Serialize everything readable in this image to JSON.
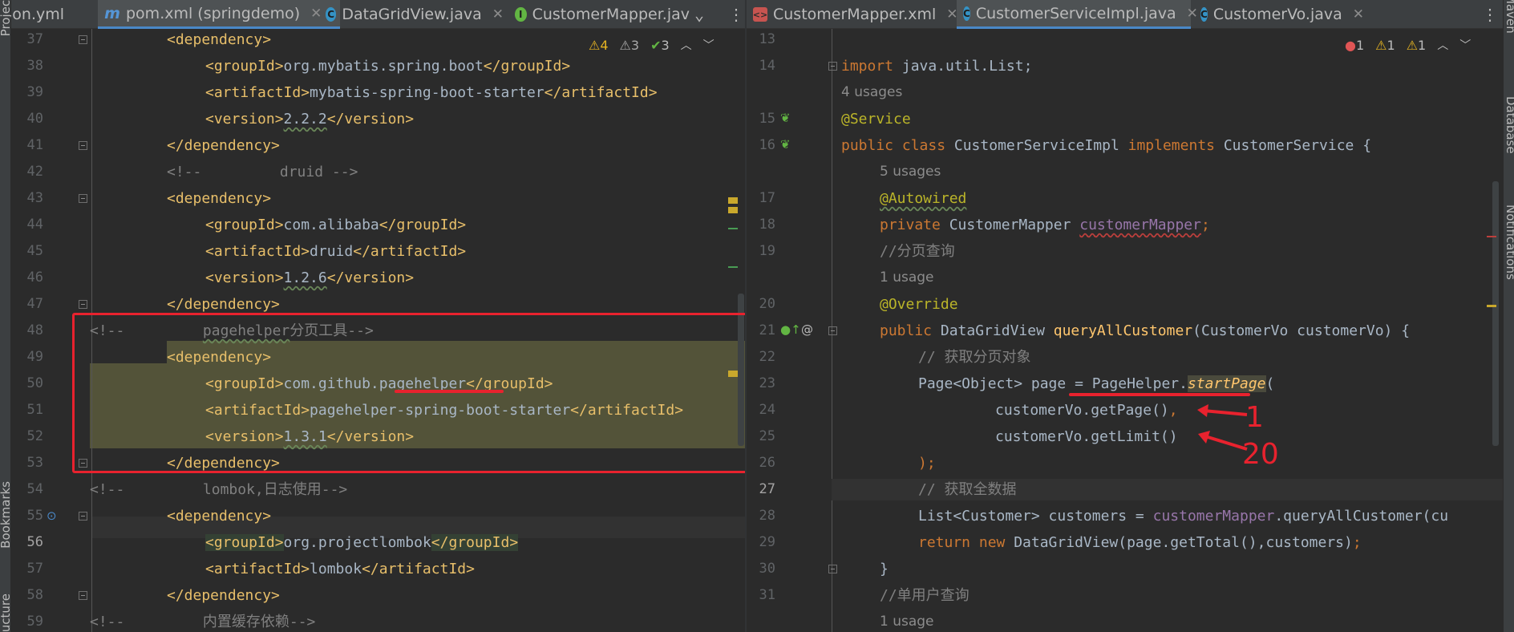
{
  "left_sidebar": {
    "labels": [
      "Project",
      "Bookmarks",
      "Structure"
    ]
  },
  "right_sidebar": {
    "labels": [
      "Maven",
      "Database",
      "Notifications"
    ]
  },
  "left_pane": {
    "tabs": [
      {
        "label": "ion.yml",
        "icon": "yaml-file-icon"
      },
      {
        "label": "pom.xml (springdemo)",
        "icon": "maven-icon",
        "active": true
      },
      {
        "label": "DataGridView.java",
        "icon": "class-icon"
      },
      {
        "label": "CustomerMapper.jav",
        "icon": "interface-icon"
      }
    ],
    "inspection": {
      "warnings": "4",
      "weak_warnings": "3",
      "typos": "3"
    },
    "lines": [
      {
        "n": "37"
      },
      {
        "n": "38"
      },
      {
        "n": "39"
      },
      {
        "n": "40"
      },
      {
        "n": "41"
      },
      {
        "n": "42"
      },
      {
        "n": "43"
      },
      {
        "n": "44"
      },
      {
        "n": "45"
      },
      {
        "n": "46"
      },
      {
        "n": "47"
      },
      {
        "n": "48"
      },
      {
        "n": "49"
      },
      {
        "n": "50"
      },
      {
        "n": "51"
      },
      {
        "n": "52"
      },
      {
        "n": "53"
      },
      {
        "n": "54"
      },
      {
        "n": "55"
      },
      {
        "n": "56"
      },
      {
        "n": "57"
      },
      {
        "n": "58"
      },
      {
        "n": "59"
      }
    ],
    "code": {
      "l37": "<dependency>",
      "l38_open": "<groupId>",
      "l38_val": "org.mybatis.spring.boot",
      "l38_close": "</groupId>",
      "l39_open": "<artifactId>",
      "l39_val": "mybatis-spring-boot-starter",
      "l39_close": "</artifactId>",
      "l40_open": "<version>",
      "l40_val": "2.2.2",
      "l40_close": "</version>",
      "l41": "</dependency>",
      "l42": "<!--         druid -->",
      "l43": "<dependency>",
      "l44_open": "<groupId>",
      "l44_val": "com.alibaba",
      "l44_close": "</groupId>",
      "l45_open": "<artifactId>",
      "l45_val": "druid",
      "l45_close": "</artifactId>",
      "l46_open": "<version>",
      "l46_val": "1.2.6",
      "l46_close": "</version>",
      "l47": "</dependency>",
      "l48_a": "<!--         ",
      "l48_b": "pagehelper",
      "l48_c": "分页工具-->",
      "l49": "<dependency>",
      "l50_open": "<groupId>",
      "l50_val_a": "com.github.",
      "l50_val_b": "pagehelper",
      "l50_close": "</groupId>",
      "l51_open": "<artifactId>",
      "l51_val": "pagehelper-spring-boot-starter",
      "l51_close": "</artifactId>",
      "l52_open": "<version>",
      "l52_val": "1.3.1",
      "l52_close": "</version>",
      "l53": "</dependency>",
      "l54_a": "<!--         ",
      "l54_b": "lombok",
      "l54_c": ",日志使用-->",
      "l55": "<dependency>",
      "l56_open": "<groupId>",
      "l56_val": "org.projectlombok",
      "l56_close": "</groupId>",
      "l57_open": "<artifactId>",
      "l57_val": "lombok",
      "l57_close": "</artifactId>",
      "l58": "</dependency>",
      "l59": "<!--         内置缓存依赖-->"
    }
  },
  "right_pane": {
    "tabs": [
      {
        "label": "CustomerMapper.xml",
        "icon": "xml-file-icon"
      },
      {
        "label": "CustomerServiceImpl.java",
        "icon": "class-icon",
        "active": true
      },
      {
        "label": "CustomerVo.java",
        "icon": "class-icon"
      }
    ],
    "inspection": {
      "errors": "1",
      "warnings": "1",
      "weak_warnings": "1"
    },
    "lines": {
      "n13": "13",
      "n14": "14",
      "n15": "15",
      "n16": "16",
      "n17": "17",
      "n18": "18",
      "n19": "19",
      "n20": "20",
      "n21": "21",
      "n22": "22",
      "n23": "23",
      "n24": "24",
      "n25": "25",
      "n26": "26",
      "n27": "27",
      "n28": "28",
      "n29": "29",
      "n30": "30",
      "n31": "31"
    },
    "code": {
      "l14_kw": "import",
      "l14_rest": " java.util.List;",
      "h_4usages": "4 usages",
      "l15": "@Service",
      "l16_kw1": "public class",
      "l16_name": " CustomerServiceImpl ",
      "l16_kw2": "implements",
      "l16_rest": " CustomerService {",
      "h_5usages": "5 usages",
      "l17": "@Autowired",
      "l18_kw": "private",
      "l18_type": " CustomerMapper ",
      "l18_field": "customerMapper",
      "l18_end": ";",
      "l19": "//分页查询",
      "h_1usage": "1 usage",
      "l20": "@Override",
      "l21_kw": "public",
      "l21_type": " DataGridView ",
      "l21_fn": "queryAllCustomer",
      "l21_rest": "(CustomerVo customerVo) {",
      "l22": "// 获取分页对象",
      "l23_a": "Page<Object> page = ",
      "l23_b": "PageHelper.",
      "l23_c": "startPage",
      "l23_d": "(",
      "l24_a": "customerVo.getPage()",
      "l24_b": ",",
      "l25": "customerVo.getLimit()",
      "l26": ");",
      "l27": "// 获取全数据",
      "l28_a": "List<Customer> customers = ",
      "l28_b": "customerMapper",
      "l28_c": ".queryAllCustomer(cu",
      "l29_kw": "return new",
      "l29_rest": " DataGridView(page.getTotal(),customers)",
      "l29_end": ";",
      "l30": "}",
      "l31": "//单用户查询",
      "h_1usage_b": "1 usage"
    },
    "annotations": {
      "arrow1_label": "1",
      "arrow2_label": "20"
    }
  }
}
